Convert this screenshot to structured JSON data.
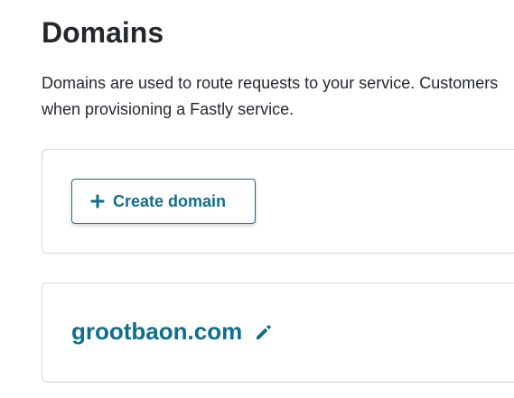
{
  "page": {
    "title": "Domains",
    "description_line1": "Domains are used to route requests to your service. Customers",
    "description_line2": "when provisioning a Fastly service."
  },
  "create_card": {
    "button_label": "Create domain",
    "button_icon": "plus-icon"
  },
  "domains": [
    {
      "name": "grootbaon.com",
      "edit_icon": "pencil-icon"
    }
  ],
  "colors": {
    "accent": "#0f6e8c",
    "text": "#24282d",
    "border": "#d4d6d9"
  }
}
